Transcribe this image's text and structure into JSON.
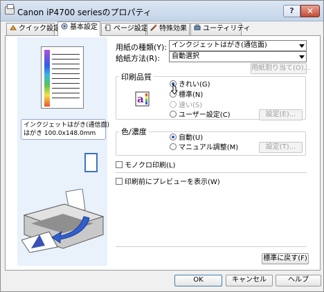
{
  "window": {
    "title": "Canon iP4700 seriesのプロパティ",
    "help_label": "?",
    "close_label": "✕"
  },
  "tabs": [
    {
      "label": "クイック設定",
      "icon": "quick-setup-icon",
      "active": false
    },
    {
      "label": "基本設定",
      "icon": "main-icon",
      "active": true
    },
    {
      "label": "ページ設定",
      "icon": "page-setup-icon",
      "active": false
    },
    {
      "label": "特殊効果",
      "icon": "effects-icon",
      "active": false
    },
    {
      "label": "ユーティリティ",
      "icon": "utility-icon",
      "active": false
    }
  ],
  "preview": {
    "paper_info_line1": "インクジェットはがき(通信面)",
    "paper_info_line2": "はがき 100.0x148.0mm"
  },
  "media": {
    "label": "用紙の種類(Y):",
    "value": "インクジェットはがき(通信面)"
  },
  "source": {
    "label": "給紙方法(R):",
    "value": "自動選択",
    "paper_alloc_label": "用紙割り当て(O)..."
  },
  "quality": {
    "title": "印刷品質",
    "high": "きれい(G)",
    "standard": "標準(N)",
    "fast": "速い(S)",
    "custom": "ユーザー設定(C)",
    "set_label": "設定(E)..."
  },
  "color": {
    "title": "色/濃度",
    "auto": "自動(U)",
    "manual": "マニュアル調整(M)",
    "set_label": "設定(T)..."
  },
  "grayscale_label": "モノクロ印刷(L)",
  "preview_before_label": "印刷前にプレビューを表示(W)",
  "defaults_label": "標準に戻す(F)",
  "footer": {
    "ok": "OK",
    "cancel": "キャンセル",
    "help": "ヘルプ"
  },
  "colors": {
    "accent": "#1f5fc4",
    "preview_bg": "#e9f1fb",
    "close_red": "#c24a35"
  }
}
